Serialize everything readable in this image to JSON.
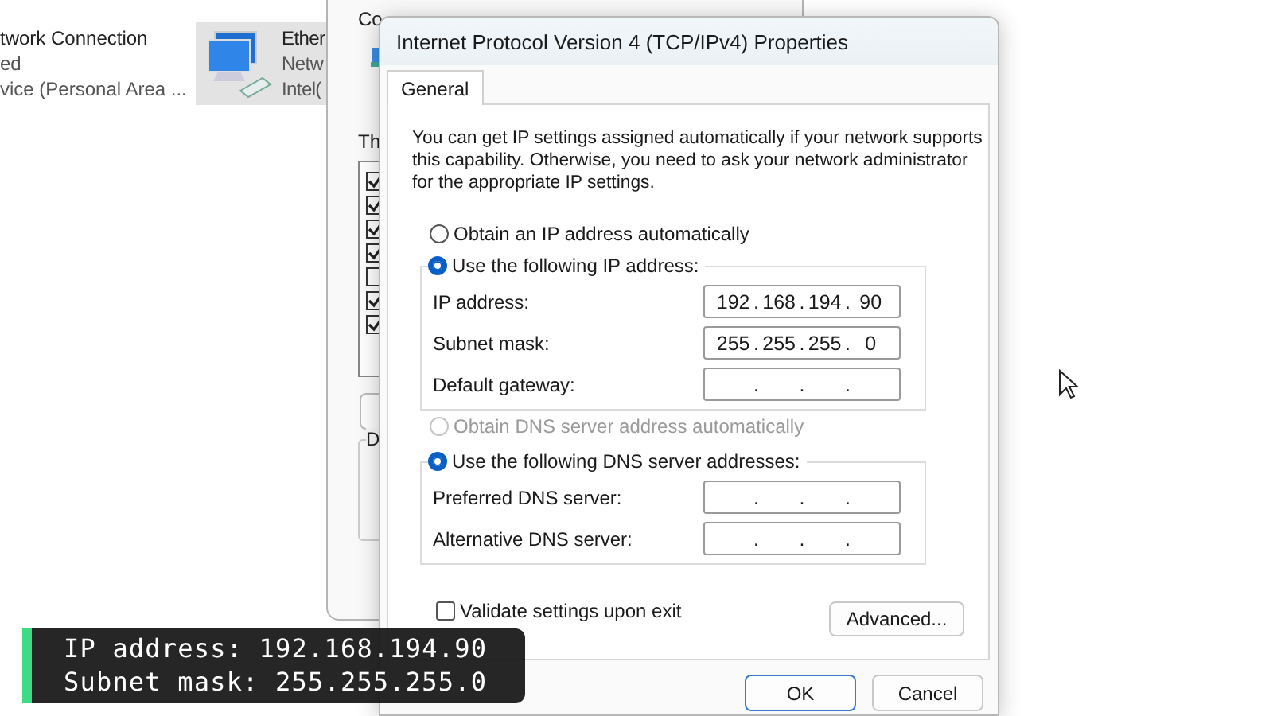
{
  "explorer": {
    "items": [
      {
        "name": "twork Connection",
        "status": "ed",
        "device": "vice (Personal Area ...",
        "selected": false
      },
      {
        "name": "Ether",
        "status": "Netw",
        "device": "Intel(",
        "selected": true
      }
    ]
  },
  "ethernet_properties": {
    "connect_label": "Co",
    "items_label": "Th",
    "description_label": "D",
    "items": [
      {
        "checked": true
      },
      {
        "checked": true
      },
      {
        "checked": true
      },
      {
        "checked": true
      },
      {
        "checked": false
      },
      {
        "checked": true
      },
      {
        "checked": true
      }
    ]
  },
  "ipv4_dialog": {
    "title": "Internet Protocol Version 4 (TCP/IPv4) Properties",
    "tabs": [
      {
        "label": "General",
        "selected": true
      }
    ],
    "intro": "You can get IP settings assigned automatically if your network supports this capability. Otherwise, you need to ask your network administrator for the appropriate IP settings.",
    "octet_separator": ".",
    "ip_auto": {
      "label": "Obtain an IP address automatically",
      "selected": false,
      "disabled": false
    },
    "ip_manual": {
      "label": "Use the following IP address:",
      "selected": true,
      "disabled": false,
      "fields": [
        {
          "label": "IP address:",
          "octets": [
            "192",
            "168",
            "194",
            "90"
          ]
        },
        {
          "label": "Subnet mask:",
          "octets": [
            "255",
            "255",
            "255",
            "0"
          ]
        },
        {
          "label": "Default gateway:"
        }
      ]
    },
    "dns_auto": {
      "label": "Obtain DNS server address automatically",
      "selected": false,
      "disabled": true
    },
    "dns_manual": {
      "label": "Use the following DNS server addresses:",
      "selected": true,
      "disabled": false,
      "fields": [
        {
          "label": "Preferred DNS server:"
        },
        {
          "label": "Alternative DNS server:"
        }
      ]
    },
    "validate": {
      "label": "Validate settings upon exit",
      "checked": false
    },
    "advanced_button": "Advanced...",
    "buttons": [
      {
        "label": "OK",
        "default": true
      },
      {
        "label": "Cancel",
        "default": false
      }
    ]
  },
  "caption": {
    "lines": [
      "IP address: 192.168.194.90",
      "Subnet mask: 255.255.255.0"
    ]
  }
}
